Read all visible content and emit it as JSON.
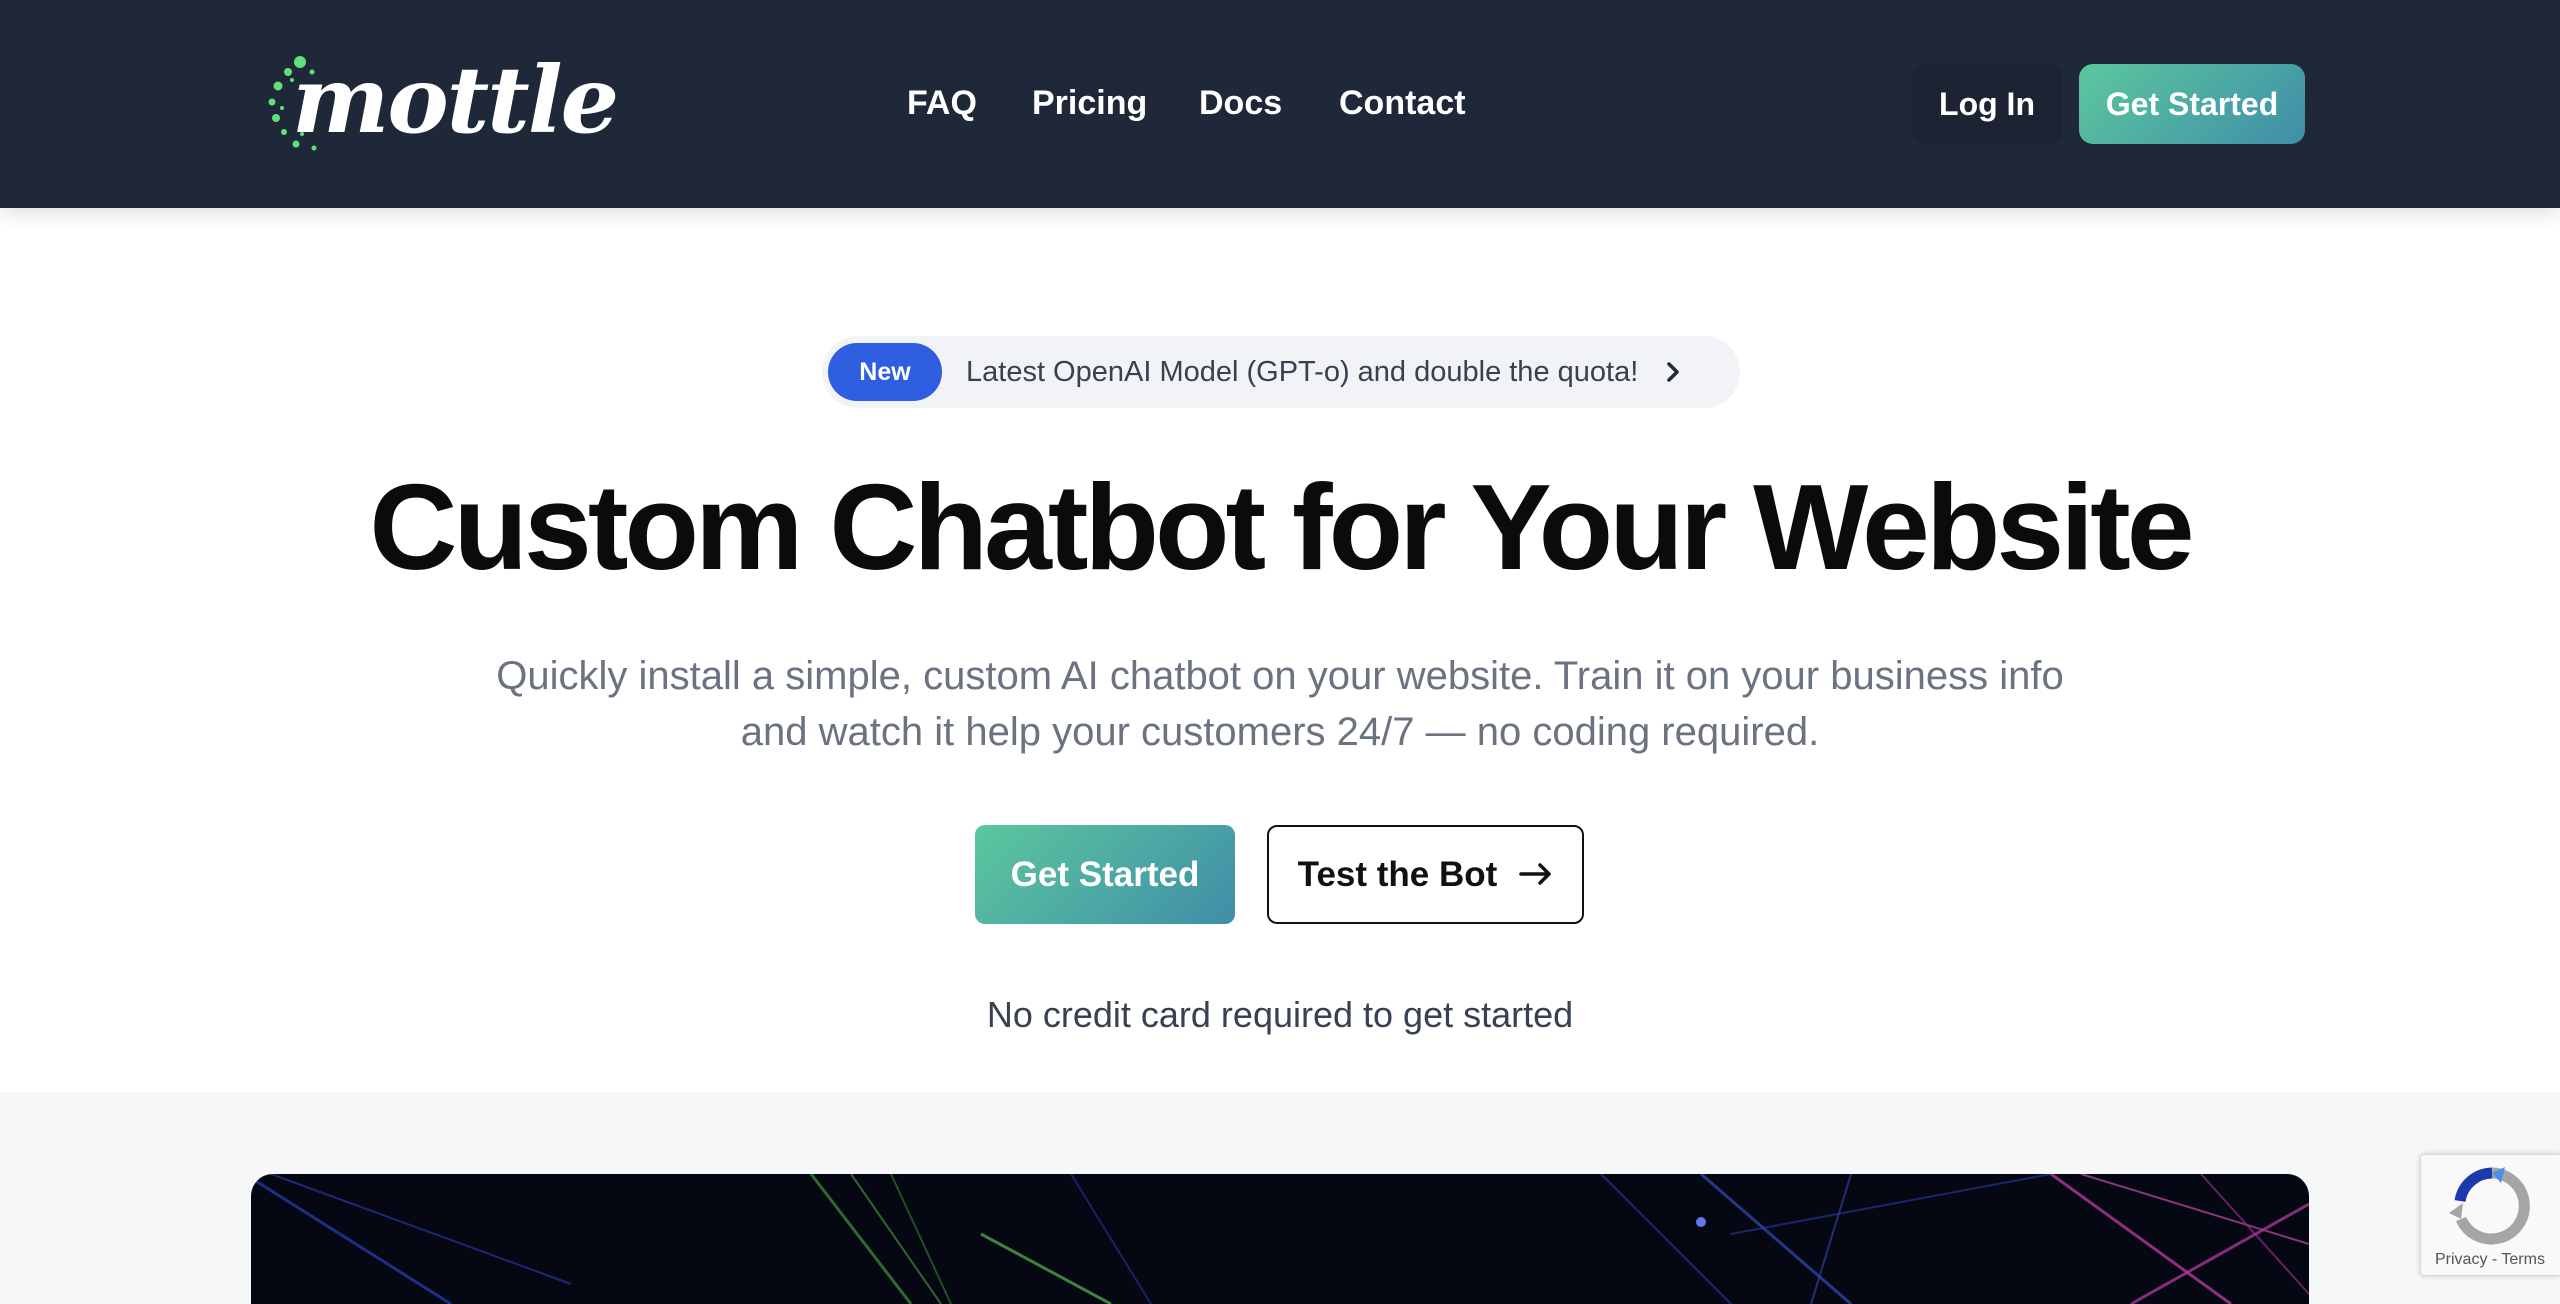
{
  "brand": {
    "name": "mottle",
    "colors": {
      "header_bg": "#1f2838",
      "accent_gradient_start": "#5cc79e",
      "accent_gradient_end": "#3f8ea8",
      "badge_blue": "#2f5fe0",
      "logo_dots": "#5fe07a"
    }
  },
  "nav": {
    "items": [
      "FAQ",
      "Pricing",
      "Docs",
      "Contact"
    ],
    "login_label": "Log In",
    "get_started_label": "Get Started"
  },
  "announcement": {
    "badge": "New",
    "text": "Latest OpenAI Model (GPT-o) and double the quota!",
    "icon": "chevron-right-icon"
  },
  "hero": {
    "title": "Custom Chatbot for Your Website",
    "subtitle": "Quickly install a simple, custom AI chatbot on your website. Train it on your business info and watch it help your customers 24/7 — no coding required.",
    "primary_cta": "Get Started",
    "secondary_cta": "Test the Bot",
    "secondary_icon": "arrow-right-icon",
    "note": "No credit card required to get started"
  },
  "recaptcha": {
    "privacy": "Privacy",
    "separator": " - ",
    "terms": "Terms",
    "icon": "recaptcha-icon"
  }
}
